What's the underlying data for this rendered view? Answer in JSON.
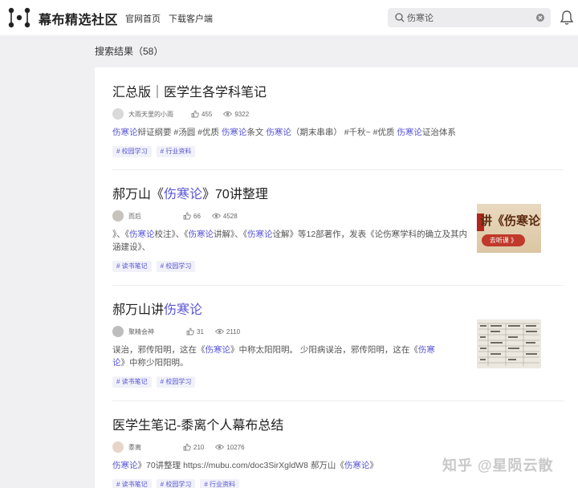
{
  "header": {
    "brand": "幕布精选社区",
    "nav": [
      "官网首页",
      "下载客户端"
    ],
    "search_value": "伤寒论"
  },
  "results_label": "搜索结果（58）",
  "results": [
    {
      "title_parts": [
        {
          "t": "汇总版｜医学生各学科笔记",
          "hl": false
        }
      ],
      "author": "大雨天里的小雨",
      "likes": "455",
      "views": "9322",
      "snippet_parts": [
        {
          "t": "伤寒论",
          "hl": true
        },
        {
          "t": "辩证纲要 #汤圆 #优质 ",
          "hl": false
        },
        {
          "t": "伤寒论",
          "hl": true
        },
        {
          "t": "条文 ",
          "hl": false
        },
        {
          "t": "伤寒论",
          "hl": true
        },
        {
          "t": "（期末串串） #千秋~ #优质 ",
          "hl": false
        },
        {
          "t": "伤寒论",
          "hl": true
        },
        {
          "t": "证治体系",
          "hl": false
        }
      ],
      "tags": [
        "# 校园学习",
        "# 行业资料"
      ]
    },
    {
      "title_parts": [
        {
          "t": "郝万山《",
          "hl": false
        },
        {
          "t": "伤寒论",
          "hl": true
        },
        {
          "t": "》70讲整理",
          "hl": false
        }
      ],
      "author": "而后",
      "likes": "66",
      "views": "4528",
      "snippet_parts": [
        {
          "t": "》、《",
          "hl": false
        },
        {
          "t": "伤寒论",
          "hl": true
        },
        {
          "t": "校注》、《",
          "hl": false
        },
        {
          "t": "伤寒论",
          "hl": true
        },
        {
          "t": "讲解》、《",
          "hl": false
        },
        {
          "t": "伤寒论",
          "hl": true
        },
        {
          "t": "诠解》等12部著作，发表《论伤寒学科的确立及其内涵建设》、",
          "hl": false
        }
      ],
      "tags": [
        "# 读书笔记",
        "# 校园学习"
      ],
      "thumb": {
        "text": "讲《伤寒论",
        "button": "去听课 》"
      }
    },
    {
      "title_parts": [
        {
          "t": "郝万山讲",
          "hl": false
        },
        {
          "t": "伤寒论",
          "hl": true
        }
      ],
      "author": "聚精会神",
      "likes": "31",
      "views": "2110",
      "snippet_parts": [
        {
          "t": "误治，邪传阳明，这在《",
          "hl": false
        },
        {
          "t": "伤寒论",
          "hl": true
        },
        {
          "t": "》中称太阳阳明。 少阳病误治，邪传阳明，这在《",
          "hl": false
        },
        {
          "t": "伤寒论",
          "hl": true
        },
        {
          "t": "》中称少阳阳明。",
          "hl": false
        }
      ],
      "tags": [
        "# 读书笔记",
        "# 校园学习"
      ]
    },
    {
      "title_parts": [
        {
          "t": "医学生笔记-黍离个人幕布总结",
          "hl": false
        }
      ],
      "author": "黍离",
      "likes": "210",
      "views": "10276",
      "snippet_parts": [
        {
          "t": "伤寒论",
          "hl": true
        },
        {
          "t": "》70讲整理 https://mubu.com/doc3SirXgldW8 郝万山《",
          "hl": false
        },
        {
          "t": "伤寒论",
          "hl": true
        },
        {
          "t": "》",
          "hl": false
        }
      ],
      "tags": [
        "# 读书笔记",
        "# 校园学习",
        "# 行业资料"
      ]
    }
  ],
  "watermark": "知乎 @星陨云散",
  "colors": {
    "accent": "#5856d6",
    "page_bg": "#f0f0f2"
  }
}
